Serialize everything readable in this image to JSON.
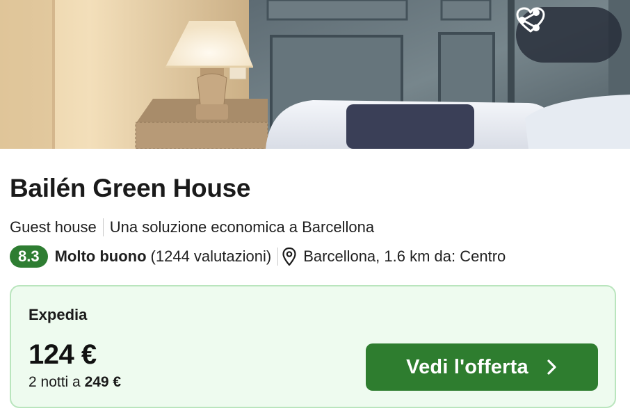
{
  "listing": {
    "name": "Bailén Green House",
    "type": "Guest house",
    "tagline": "Una soluzione economica a Barcellona",
    "rating_score": "8.3",
    "rating_label": "Molto buono",
    "reviews": "(1244 valutazioni)",
    "location": "Barcellona, 1.6 km da: Centro"
  },
  "hero": {
    "actions": [
      "share-icon",
      "heart-icon"
    ]
  },
  "offer": {
    "provider": "Expedia",
    "price": "124 €",
    "total_prefix": "2 notti a",
    "total_price": "249 €",
    "cta_label": "Vedi l'offerta"
  },
  "colors": {
    "accent_green": "#2e7d32",
    "offer_bg": "#eefbef",
    "offer_border": "#b9e5bd"
  }
}
